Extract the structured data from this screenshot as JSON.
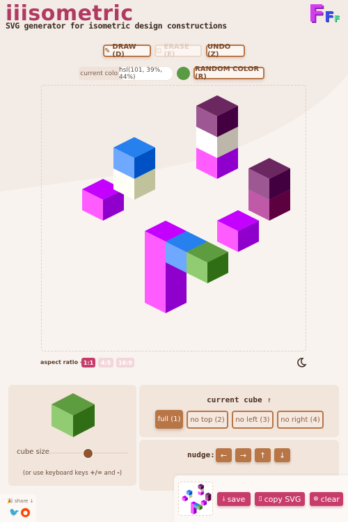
{
  "header": {
    "title": "iiisometric",
    "subtitle": "SVG generator for isometric design constructions",
    "logo_letters": [
      "F",
      "F",
      "F"
    ]
  },
  "toolbar": {
    "draw": "DRAW (D)",
    "erase": "ERASE (E)",
    "undo": "UNDO (Z)",
    "pencil_icon": "pencil-icon",
    "erase_icon": "eraser-icon"
  },
  "color": {
    "label": "current color",
    "value": "hsl(101, 39%, 44%)",
    "swatch": "#5a9a44",
    "random": "RANDOM COLOR (R)"
  },
  "aspect": {
    "label": "aspect ratio →",
    "options": [
      "1:1",
      "4:5",
      "16:9"
    ],
    "selected": "1:1"
  },
  "theme_icon": "moon-icon",
  "cube_panel": {
    "size_label": "cube size",
    "size_value": 0.5,
    "hint_pre": "(or use keyboard keys ",
    "hint_keys1": "+/=",
    "hint_mid": " and ",
    "hint_keys2": "-",
    "hint_post": ")",
    "preview_colors": {
      "top": "#5e9c40",
      "left": "#91cc72",
      "right": "#2f6e14"
    }
  },
  "current_cube": {
    "title": "current cube",
    "icon": "cursor-icon",
    "options": [
      "full (1)",
      "no top (2)",
      "no left (3)",
      "no right (4)"
    ],
    "selected": "full (1)"
  },
  "nudge": {
    "label": "nudge:",
    "buttons": [
      "←",
      "→",
      "↑",
      "↓"
    ]
  },
  "actions": {
    "save": "save",
    "copy": "copy SVG",
    "clear": "clear"
  },
  "share": {
    "label": "🎉 share ↓"
  },
  "colors": {
    "accent": "#b87545",
    "brand": "#b03a62",
    "action": "#c73c6a",
    "background": "#f8f3ef",
    "panel": "#f1e5dc"
  }
}
